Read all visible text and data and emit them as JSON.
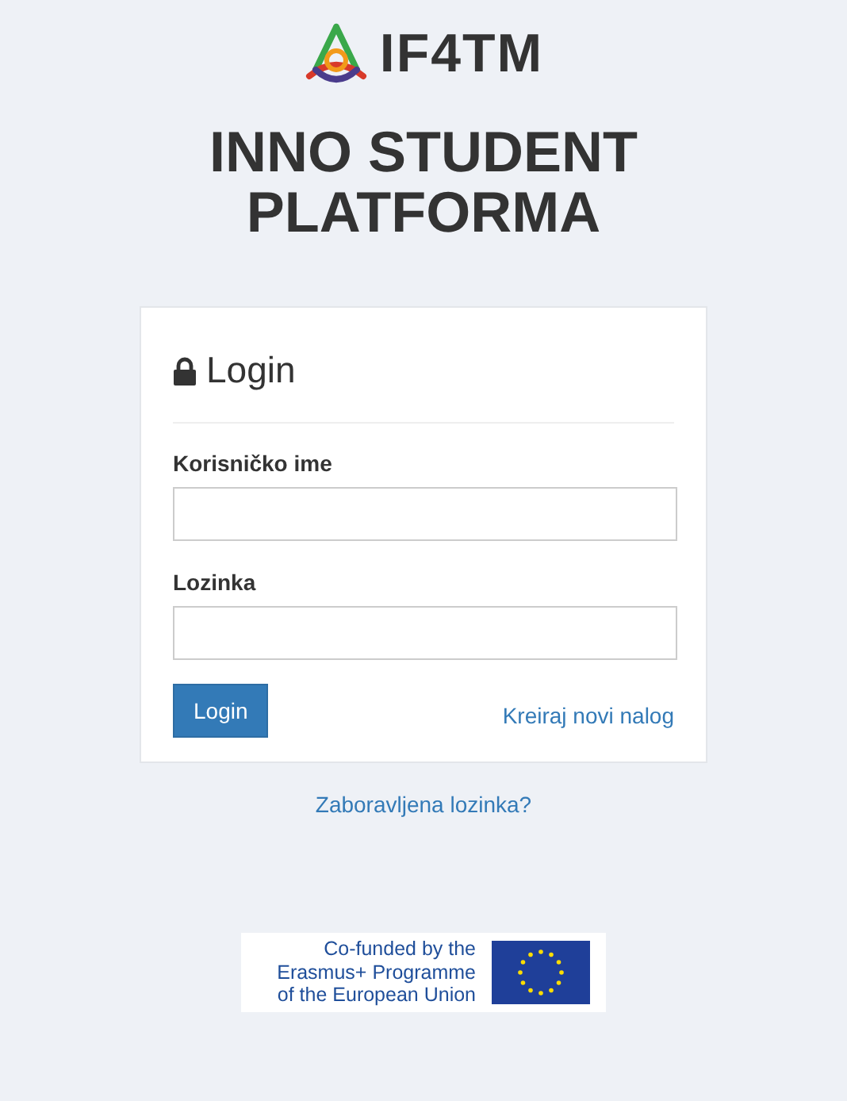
{
  "logo": {
    "text": "IF4TM"
  },
  "title": "INNO STUDENT PLATFORMA",
  "login_panel": {
    "heading": "Login",
    "fields": [
      {
        "label": "Korisničko ime"
      },
      {
        "label": "Lozinka"
      }
    ],
    "submit": "Login",
    "register_link": "Kreiraj novi nalog"
  },
  "forgot_link": "Zaboravljena lozinka?",
  "funding_badge": {
    "lines": [
      "Co-funded by the",
      "Erasmus+ Programme",
      "of the European Union"
    ]
  }
}
